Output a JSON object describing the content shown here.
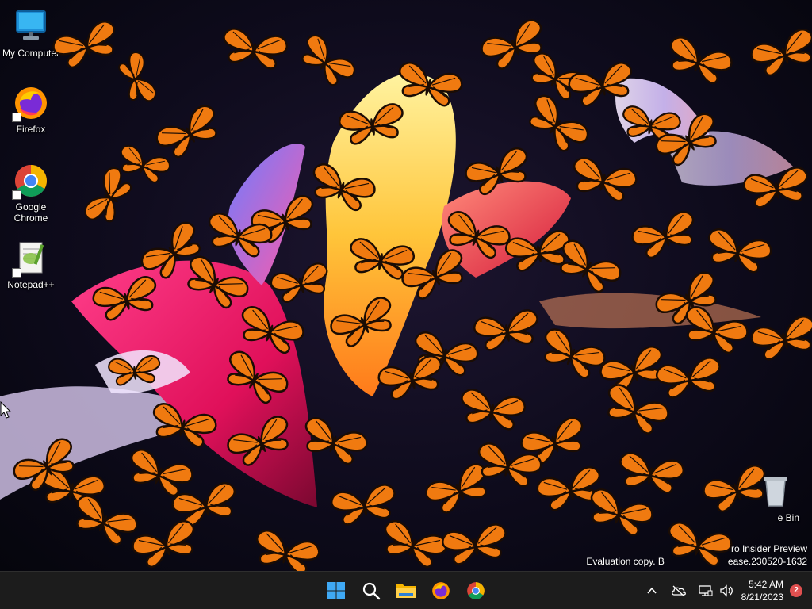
{
  "desktop": {
    "icons": [
      {
        "label": "My Computer",
        "icon": "monitor-icon"
      },
      {
        "label": "Firefox",
        "icon": "firefox-icon"
      },
      {
        "label": "Google Chrome",
        "icon": "chrome-icon"
      },
      {
        "label": "Notepad++",
        "icon": "notepadpp-icon"
      },
      {
        "label": "Recycle Bin",
        "icon": "recycle-bin-icon"
      }
    ],
    "recycle_visible_label": "e Bin",
    "watermark": {
      "line1": "ro Insider Preview",
      "line2": "Evaluation copy. B",
      "line2_suffix": "ease.230520-1632"
    }
  },
  "taskbar": {
    "pinned": [
      {
        "name": "start",
        "icon": "windows-logo-icon"
      },
      {
        "name": "search",
        "icon": "search-icon"
      },
      {
        "name": "file-explorer",
        "icon": "folder-icon"
      },
      {
        "name": "firefox",
        "icon": "firefox-icon"
      },
      {
        "name": "chrome",
        "icon": "chrome-icon"
      }
    ],
    "tray": {
      "icons": [
        "chevron-up-icon",
        "onedrive-icon",
        "network-icon",
        "volume-icon"
      ],
      "time": "5:42 AM",
      "date": "8/21/2023",
      "notifications": "2"
    }
  },
  "colors": {
    "butterfly_orange": "#f07a10",
    "butterfly_black": "#1a0c04",
    "taskbar_bg": "#1c1c1c",
    "badge": "#e05050"
  }
}
